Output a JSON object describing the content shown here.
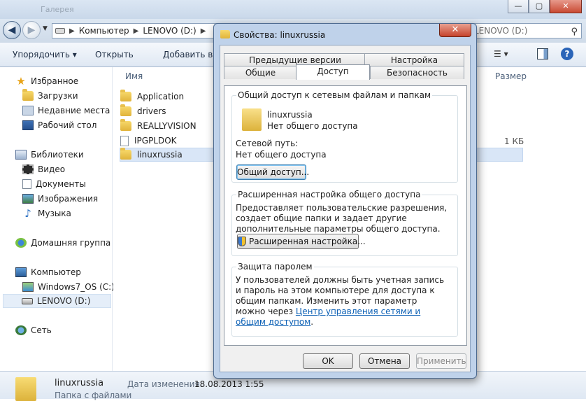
{
  "explorer": {
    "ghost_title": "Галерея",
    "address_path": [
      "Компьютер",
      "LENOVO (D:)"
    ],
    "search_placeholder": "LENOVO (D:)",
    "toolbar": {
      "organize": "Упорядочить ▾",
      "open": "Открыть",
      "add_to_library": "Добавить в библиотеку",
      "view": "☰ ▾"
    },
    "nav": {
      "favorites": "Избранное",
      "downloads": "Загрузки",
      "recent": "Недавние места",
      "desktop": "Рабочий стол",
      "libraries": "Библиотеки",
      "video": "Видео",
      "documents": "Документы",
      "pictures": "Изображения",
      "music": "Музыка",
      "homegroup": "Домашняя группа",
      "computer": "Компьютер",
      "drive_c": "Windows7_OS (C:)",
      "drive_d": "LENOVO (D:)",
      "network": "Сеть"
    },
    "columns": {
      "name": "Имя",
      "size": "Размер"
    },
    "files": [
      {
        "name": "Application",
        "type": "folder"
      },
      {
        "name": "drivers",
        "type": "folder"
      },
      {
        "name": "REALLYVISION",
        "type": "folder"
      },
      {
        "name": "IPGPLDOK",
        "type": "file",
        "size": "1 КБ"
      },
      {
        "name": "linuxrussia",
        "type": "folder"
      }
    ],
    "details": {
      "name": "linuxrussia",
      "type": "Папка с файлами",
      "date_label": "Дата изменения:",
      "date": "18.08.2013 1:55"
    }
  },
  "dialog": {
    "title": "Свойства: linuxrussia",
    "close": "✕",
    "tabs": {
      "previous_versions": "Предыдущие версии",
      "customize": "Настройка",
      "general": "Общие",
      "sharing": "Доступ",
      "security": "Безопасность"
    },
    "network_sharing": {
      "title": "Общий доступ к сетевым файлам и папкам",
      "folder_name": "linuxrussia",
      "status": "Нет общего доступа",
      "path_label": "Сетевой путь:",
      "path_value": "Нет общего доступа",
      "share_button": "Общий доступ..."
    },
    "advanced_sharing": {
      "title": "Расширенная настройка общего доступа",
      "description": "Предоставляет пользовательские разрешения, создает общие папки и задает другие дополнительные параметры общего доступа.",
      "button": "Расширенная настройка..."
    },
    "password_protection": {
      "title": "Защита паролем",
      "description": "У пользователей должны быть учетная запись и пароль на этом компьютере для доступа к общим папкам.",
      "change_text": "Изменить этот параметр можно через",
      "link": "Центр управления сетями и общим доступом",
      "period": "."
    },
    "buttons": {
      "ok": "OK",
      "cancel": "Отмена",
      "apply": "Применить"
    }
  }
}
